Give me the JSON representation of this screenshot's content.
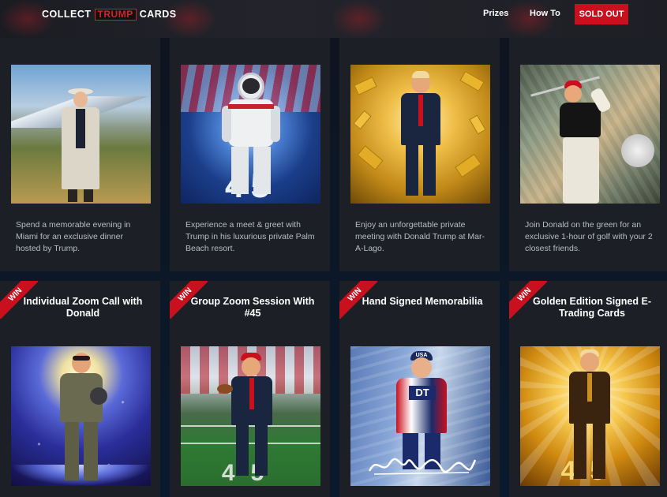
{
  "header": {
    "logo_left": "COLLECT",
    "logo_mid": "TRUMP",
    "logo_right": "CARDS",
    "nav": [
      "Prizes",
      "How To"
    ],
    "cta": "SOLD OUT"
  },
  "row1": [
    {
      "description": "Spend a memorable evening in Miami for an exclusive dinner hosted by Trump."
    },
    {
      "description": "Experience a meet & greet with Trump in his luxurious private Palm Beach resort."
    },
    {
      "description": "Enjoy an unforgettable private meeting with Donald Trump at Mar-A-Lago."
    },
    {
      "description": "Join Donald on the green for an exclusive 1-hour of golf with your 2 closest friends."
    }
  ],
  "row2": [
    {
      "badge": "WIN",
      "title": "Individual Zoom Call with Donald"
    },
    {
      "badge": "WIN",
      "title": "Group Zoom Session With #45"
    },
    {
      "badge": "WIN",
      "title": "Hand Signed Memorabilia"
    },
    {
      "badge": "WIN",
      "title": "Golden Edition Signed E-Trading Cards"
    }
  ],
  "image_text": {
    "astronaut_number": "45",
    "football_number": "45",
    "golden_number": "45",
    "cap_text": "USA",
    "jersey_text": "DT"
  },
  "colors": {
    "accent": "#c8101e",
    "card_bg": "#1c1f26",
    "page_bg": "#0d1117"
  }
}
